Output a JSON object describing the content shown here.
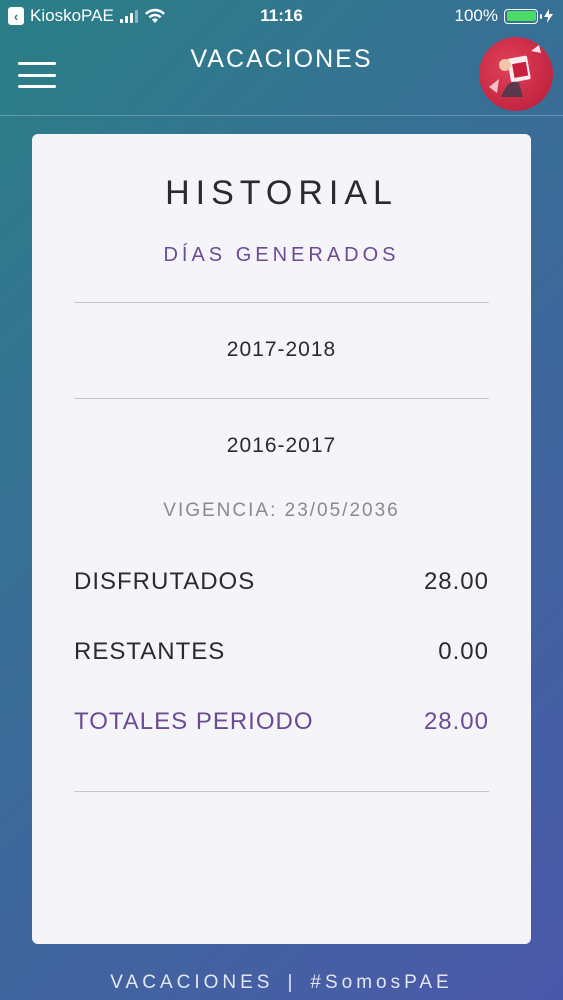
{
  "status_bar": {
    "carrier": "KioskoPAE",
    "time": "11:16",
    "battery": "100%",
    "battery_level": 1.0,
    "battery_color": "#4cd964"
  },
  "header": {
    "title": "VACACIONES",
    "menu_icon": "hamburger-icon",
    "avatar_icon": "profile-avatar"
  },
  "card": {
    "title": "HISTORIAL",
    "subtitle": "DÍAS GENERADOS",
    "periods": [
      "2017-2018",
      "2016-2017"
    ],
    "vigencia": "VIGENCIA: 23/05/2036",
    "rows": [
      {
        "label": "DISFRUTADOS",
        "value": "28.00"
      },
      {
        "label": "RESTANTES",
        "value": "0.00"
      },
      {
        "label": "TOTALES PERIODO",
        "value": "28.00"
      }
    ]
  },
  "footer": {
    "left": "VACACIONES",
    "separator": "|",
    "right": "#SomosPAE"
  },
  "colors": {
    "accent": "#6c4a94",
    "gradient_start": "#2a7f86",
    "gradient_end": "#4b58aa"
  }
}
